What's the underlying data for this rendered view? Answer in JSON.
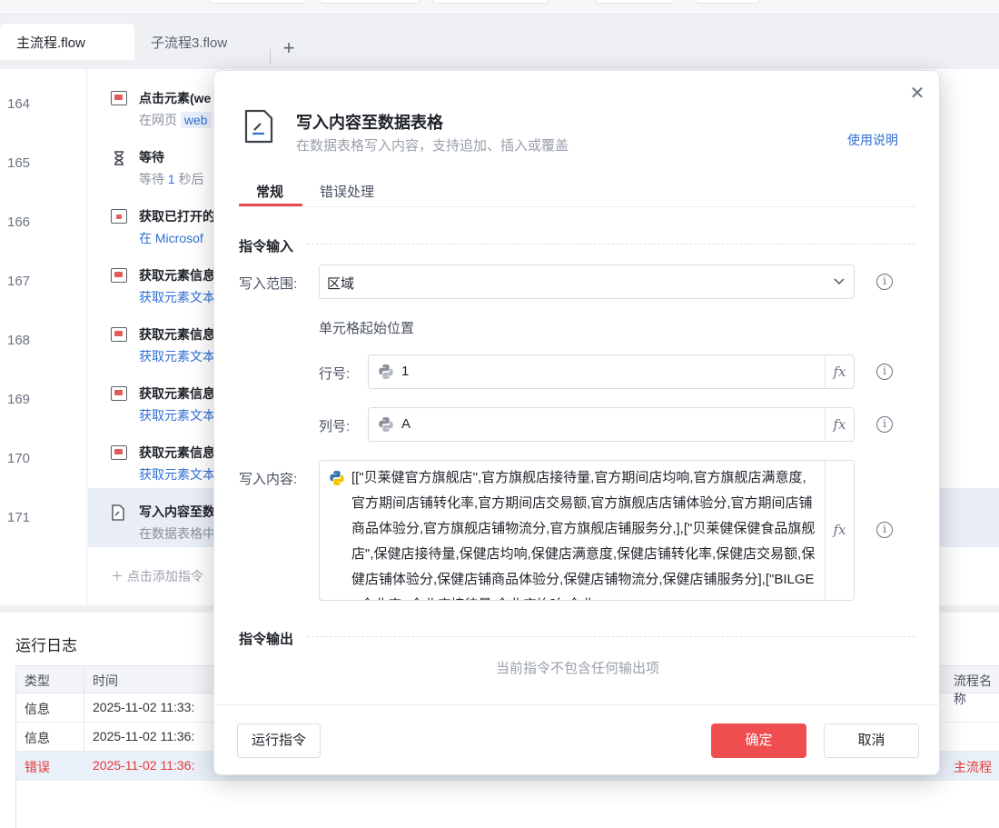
{
  "tabs": [
    {
      "label": "主流程.flow"
    },
    {
      "label": "子流程3.flow"
    }
  ],
  "tab_add": "+",
  "steps": [
    {
      "line": "164",
      "title": "点击元素(we",
      "sub_prefix": "在网页 ",
      "sub_tag": "web"
    },
    {
      "line": "165",
      "title": "等待",
      "sub_prefix": "等待 ",
      "sub_num": "1",
      "sub_suffix": " 秒后"
    },
    {
      "line": "166",
      "title": "获取已打开的",
      "sub": "在 Microsof"
    },
    {
      "line": "167",
      "title": "获取元素信息",
      "sub": "获取元素文本"
    },
    {
      "line": "168",
      "title": "获取元素信息",
      "sub": "获取元素文本"
    },
    {
      "line": "169",
      "title": "获取元素信息",
      "sub": "获取元素文本"
    },
    {
      "line": "170",
      "title": "获取元素信息",
      "sub": "获取元素文本"
    },
    {
      "line": "171",
      "title": "写入内容至数",
      "sub": "在数据表格中"
    }
  ],
  "add_step": "＋  点击添加指令",
  "log": {
    "title": "运行日志",
    "headers": {
      "type": "类型",
      "time": "时间",
      "flow": "流程名称"
    },
    "rows": [
      {
        "type": "信息",
        "time": "2025-11-02 11:33:",
        "flow": ""
      },
      {
        "type": "信息",
        "time": "2025-11-02 11:36:",
        "flow": ""
      },
      {
        "type": "错误",
        "time": "2025-11-02 11:36:",
        "flow": "主流程"
      }
    ]
  },
  "modal": {
    "title": "写入内容至数据表格",
    "description": "在数据表格写入内容，支持追加、插入或覆盖",
    "help_link": "使用说明",
    "tabs": {
      "general": "常规",
      "error": "错误处理"
    },
    "input_section": "指令输入",
    "range_label": "写入范围:",
    "range_value": "区域",
    "cell_start_label": "单元格起始位置",
    "row_label": "行号:",
    "row_value": "1",
    "col_label": "列号:",
    "col_value": "A",
    "content_label": "写入内容:",
    "content_value": "[[\"贝莱健官方旗舰店\",官方旗舰店接待量,官方期间店均响,官方旗舰店满意度,官方期间店铺转化率,官方期间店交易额,官方旗舰店店铺体验分,官方期间店铺商品体验分,官方旗舰店铺物流分,官方旗舰店铺服务分,],[\"贝莱健保健食品旗舰店\",保健店接待量,保健店均响,保健店满意度,保健店铺转化率,保健店交易额,保健店铺体验分,保健店铺商品体验分,保健店铺物流分,保健店铺服务分],[\"BILGEE企业店\",企业店接待量,企业店均响,企业",
    "fx": "fx",
    "output_section": "指令输出",
    "no_output": "当前指令不包含任何输出项",
    "buttons": {
      "run": "运行指令",
      "ok": "确定",
      "cancel": "取消"
    }
  },
  "colors": {
    "accent_red": "#f04d4f",
    "link_blue": "#2f6fd1",
    "error_red": "#e53935"
  }
}
